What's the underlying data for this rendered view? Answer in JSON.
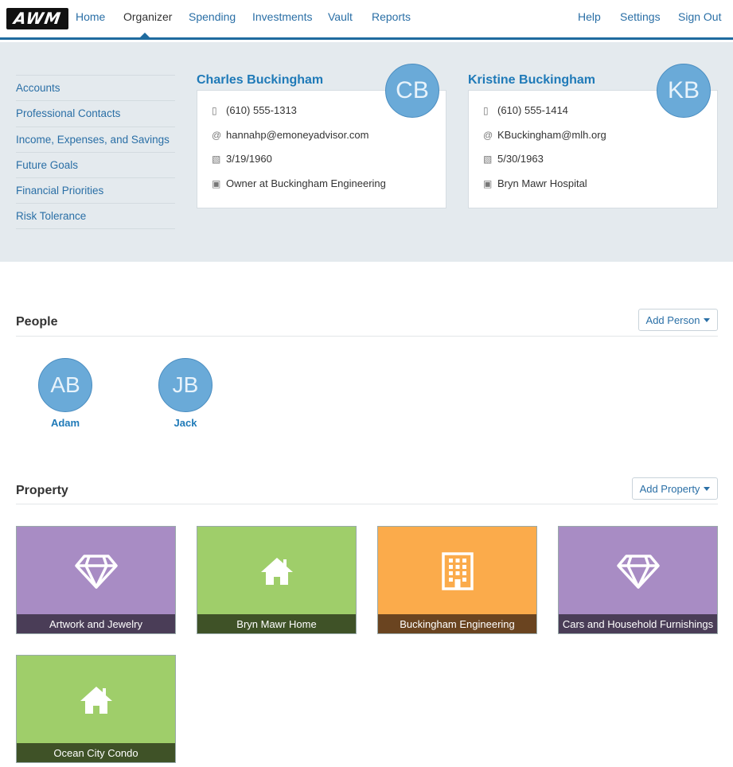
{
  "nav": {
    "logo": "AWM",
    "items": [
      "Home",
      "Organizer",
      "Spending",
      "Investments",
      "Vault",
      "Reports"
    ],
    "right_items": [
      "Help",
      "Settings",
      "Sign Out"
    ],
    "active": "Organizer"
  },
  "sidebar": {
    "items": [
      "Accounts",
      "Professional Contacts",
      "Income, Expenses, and Savings",
      "Future Goals",
      "Financial Priorities",
      "Risk Tolerance"
    ]
  },
  "clients": [
    {
      "name": "Charles Buckingham",
      "initials": "CB",
      "phone": "(610) 555-1313",
      "email": "hannahp@emoneyadvisor.com",
      "birthdate": "3/19/1960",
      "work": "Owner at Buckingham Engineering"
    },
    {
      "name": "Kristine Buckingham",
      "initials": "KB",
      "phone": "(610) 555-1414",
      "email": "KBuckingham@mlh.org",
      "birthdate": "5/30/1963",
      "work": "Bryn Mawr Hospital"
    }
  ],
  "people": {
    "title": "People",
    "add_label": "Add Person",
    "items": [
      {
        "initials": "AB",
        "name": "Adam"
      },
      {
        "initials": "JB",
        "name": "Jack"
      }
    ]
  },
  "property": {
    "title": "Property",
    "add_label": "Add Property",
    "items": [
      {
        "label": "Artwork and Jewelry",
        "icon": "diamond-icon",
        "color": "#a88cc4",
        "band": "#4a3d57"
      },
      {
        "label": "Bryn Mawr Home",
        "icon": "house-icon",
        "color": "#9fce6a",
        "band": "#3f5227"
      },
      {
        "label": "Buckingham Engineering",
        "icon": "building-icon",
        "color": "#fbab4b",
        "band": "#6a4420"
      },
      {
        "label": "Cars and Household Furnishings",
        "icon": "diamond-icon",
        "color": "#a88cc4",
        "band": "#4a3d57"
      },
      {
        "label": "Ocean City Condo",
        "icon": "house-icon",
        "color": "#9fce6a",
        "band": "#3f5227"
      }
    ]
  },
  "icons": {
    "phone": "phone-icon",
    "email": "at-icon",
    "birthday": "cake-icon",
    "work": "briefcase-icon"
  }
}
